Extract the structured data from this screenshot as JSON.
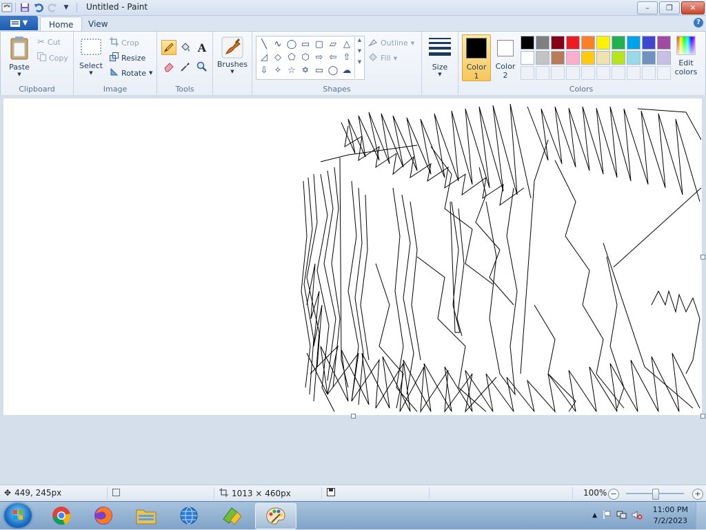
{
  "window": {
    "title": "Untitled - Paint",
    "minimize": "–",
    "maximize": "❐",
    "close": "✕"
  },
  "tabs": {
    "home": "Home",
    "view": "View",
    "help": "?"
  },
  "clipboard": {
    "group": "Clipboard",
    "paste": "Paste",
    "cut": "Cut",
    "copy": "Copy"
  },
  "image": {
    "group": "Image",
    "select": "Select",
    "crop": "Crop",
    "resize": "Resize",
    "rotate": "Rotate"
  },
  "tools": {
    "group": "Tools"
  },
  "brushes": {
    "label": "Brushes"
  },
  "shapes": {
    "group": "Shapes",
    "outline": "Outline",
    "fill": "Fill"
  },
  "size": {
    "label": "Size"
  },
  "colors": {
    "group": "Colors",
    "color1_line1": "Color",
    "color1_line2": "1",
    "color2_line1": "Color",
    "color2_line2": "2",
    "edit_line1": "Edit",
    "edit_line2": "colors",
    "color1_value": "#000000",
    "color2_value": "#ffffff",
    "palette_row1": [
      "#000000",
      "#7f7f7f",
      "#880015",
      "#ed1c24",
      "#ff7f27",
      "#fff200",
      "#22b14c",
      "#00a2e8",
      "#3f48cc",
      "#a349a4"
    ],
    "palette_row2": [
      "#ffffff",
      "#c3c3c3",
      "#b97a57",
      "#ffaec9",
      "#ffc90e",
      "#efe4b0",
      "#b5e61d",
      "#99d9ea",
      "#7092be",
      "#c8bfe7"
    ]
  },
  "status": {
    "cursor_pos": "449, 245px",
    "canvas_size": "1013 × 460px",
    "zoom": "100%"
  },
  "taskbar": {
    "time": "11:00 PM",
    "date": "7/2/2023"
  }
}
